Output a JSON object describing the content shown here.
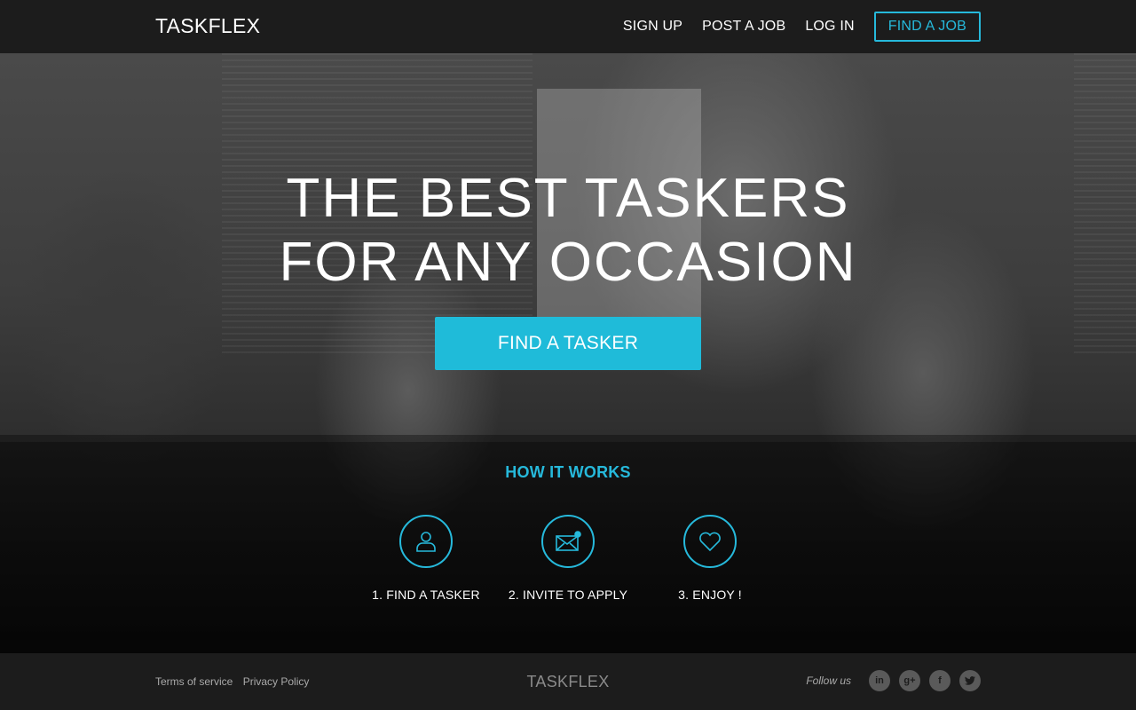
{
  "nav": {
    "brand": "TASKFLEX",
    "links": [
      "SIGN UP",
      "POST A JOB",
      "LOG IN"
    ],
    "cta": "FIND A JOB"
  },
  "hero": {
    "title_line1": "THE BEST TASKERS",
    "title_line2": "FOR ANY OCCASION",
    "cta": "FIND A TASKER"
  },
  "how_it_works": {
    "title": "HOW IT WORKS",
    "steps": [
      {
        "label": "1. FIND A TASKER",
        "icon": "user-icon"
      },
      {
        "label": "2. INVITE TO APPLY",
        "icon": "envelope-icon"
      },
      {
        "label": "3. ENJOY !",
        "icon": "heart-icon"
      }
    ]
  },
  "footer": {
    "links": [
      "Terms of service",
      "Privacy Policy"
    ],
    "brand": "TASKFLEX",
    "follow_label": "Follow us",
    "social": [
      "linkedin-icon",
      "google-plus-icon",
      "facebook-icon",
      "twitter-icon"
    ]
  },
  "colors": {
    "accent": "#1fbbd9",
    "nav_bg": "#1c1c1c"
  }
}
